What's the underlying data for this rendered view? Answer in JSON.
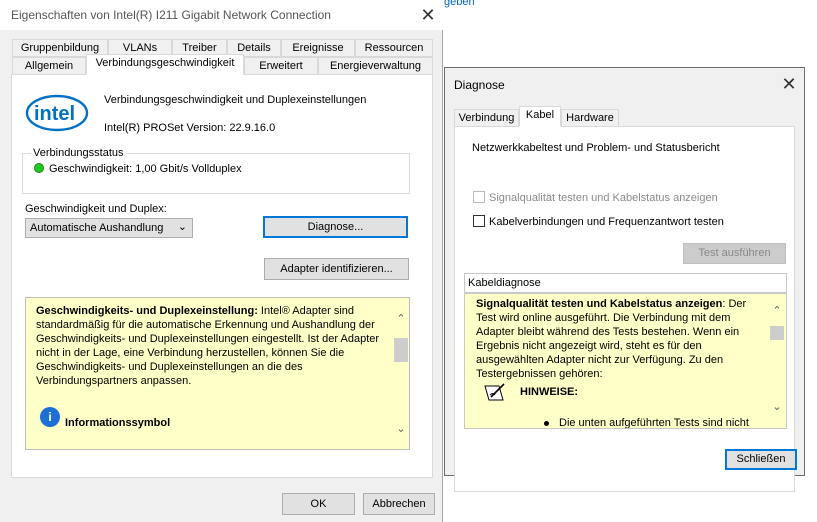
{
  "background": {
    "link_fragment": "geben"
  },
  "main_window": {
    "title": "Eigenschaften von Intel(R) I211 Gigabit Network Connection",
    "close_glyph": "✕",
    "tabs_row1": [
      "Gruppenbildung",
      "VLANs",
      "Treiber",
      "Details",
      "Ereignisse",
      "Ressourcen"
    ],
    "tabs_row2": [
      "Allgemein",
      "Verbindungsgeschwindigkeit",
      "Erweitert",
      "Energieverwaltung"
    ],
    "active_tab": "Verbindungsgeschwindigkeit",
    "logo_text": "intel",
    "heading": "Verbindungsgeschwindigkeit und Duplexeinstellungen",
    "version": "Intel(R) PROSet Version: 22.9.16.0",
    "status_group_label": "Verbindungsstatus",
    "speed_text": "Geschwindigkeit: 1,00 Gbit/s Vollduplex",
    "duplex_label": "Geschwindigkeit und Duplex:",
    "duplex_value": "Automatische Aushandlung",
    "diagnose_button": "Diagnose...",
    "identify_button": "Adapter identifizieren...",
    "help_title": "Geschwindigkeits- und Duplexeinstellung:",
    "help_body": "Intel® Adapter sind standardmäßig für die automatische Erkennung und Aushandlung der Geschwindigkeits- und Duplexeinstellungen eingestellt. Ist der Adapter nicht in der Lage, eine Verbindung herzustellen, können Sie die Geschwindigkeits- und Duplexeinstellungen an die des Verbindungspartners anpassen.",
    "info_label": "Informationssymbol",
    "ok_button": "OK",
    "cancel_button": "Abbrechen",
    "accent_color": "#0078d7",
    "help_bg_color": "#ffffc8"
  },
  "diagnose_dialog": {
    "title": "Diagnose",
    "close_glyph": "✕",
    "tabs": [
      "Verbindung",
      "Kabel",
      "Hardware"
    ],
    "active_tab": "Kabel",
    "description": "Netzwerkkabeltest und Problem- und Statusbericht",
    "check1_label": "Signalqualität testen und Kabelstatus anzeigen",
    "check1_checked": false,
    "check1_disabled": true,
    "check2_label": "Kabelverbindungen und Frequenzantwort testen",
    "check2_checked": false,
    "run_button": "Test ausführen",
    "field_value": "Kabeldiagnose",
    "help_title": "Signalqualität testen und Kabelstatus anzeigen",
    "help_body": ": Der Test wird online ausgeführt. Die Verbindung mit dem Adapter bleibt während des Tests bestehen. Wenn ein Ergebnis nicht angezeigt wird, steht es für den ausgewählten Adapter nicht zur Verfügung. Zu den Testergebnissen gehören:",
    "notes_label": "HINWEISE:",
    "bullet_text": "Die unten aufgeführten Tests sind nicht",
    "close_button": "Schließen"
  }
}
